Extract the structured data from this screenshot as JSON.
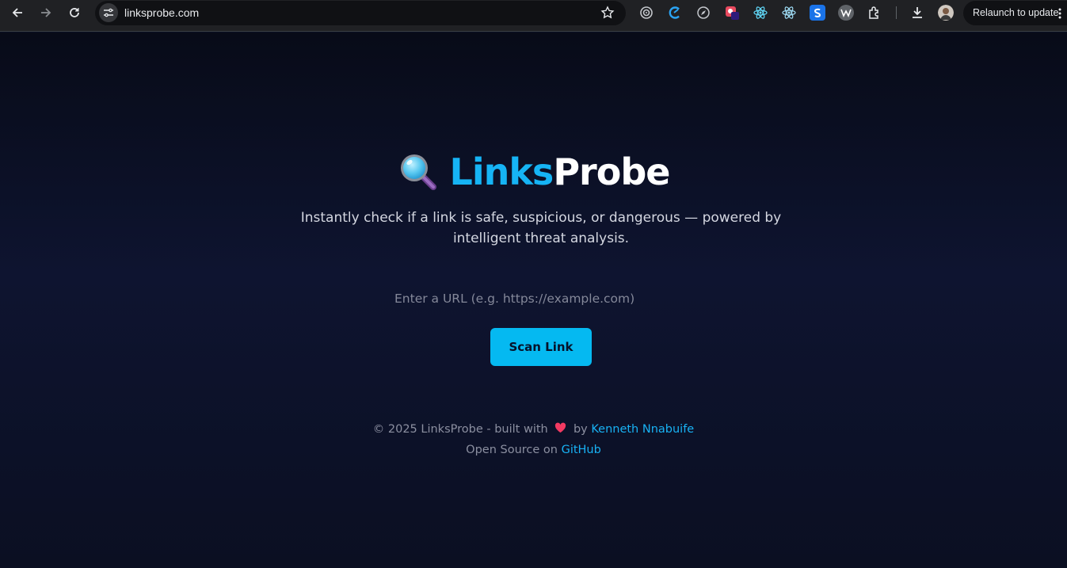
{
  "browser": {
    "url": "linksprobe.com",
    "relaunch_label": "Relaunch to update",
    "icons": [
      "back-icon",
      "forward-icon",
      "reload-icon",
      "site-info-icon",
      "bookmark-star-icon",
      "extension-target-icon",
      "extension-c-icon",
      "extension-compass-icon",
      "extension-red-icon",
      "extension-react-icon",
      "extension-react-devtools-icon",
      "extension-s-icon",
      "extension-w-icon",
      "extensions-puzzle-icon",
      "download-icon",
      "profile-avatar",
      "more-menu-icon"
    ]
  },
  "hero": {
    "icon": "magnifying-glass-icon",
    "title_part1": "Links",
    "title_part2": "Probe",
    "tagline": "Instantly check if a link is safe, suspicious, or dangerous — powered by intelligent threat analysis."
  },
  "scan": {
    "input_value": "",
    "input_placeholder": "Enter a URL (e.g. https://example.com)",
    "button_label": "Scan Link"
  },
  "footer": {
    "copyright": "© 2025 LinksProbe - built with",
    "by": "by",
    "author": "Kenneth Nnabuife",
    "open_source": "Open Source on",
    "github": "GitHub"
  },
  "colors": {
    "accent": "#05b9f1",
    "title_blue": "#16b4f5",
    "background": "#0c1024",
    "link": "#18b2f4"
  }
}
